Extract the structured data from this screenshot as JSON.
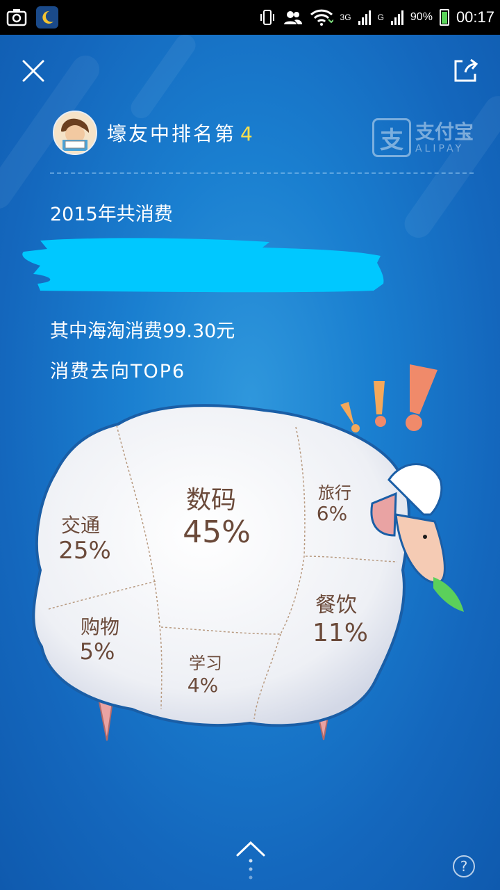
{
  "status_bar": {
    "time": "00:17",
    "battery": "90%",
    "network_3g": "3G",
    "network_g": "G"
  },
  "header": {
    "rank_prefix": "壕友中排名第",
    "rank_number": "4",
    "brand_cn": "支付宝",
    "brand_en": "ALIPAY",
    "brand_mark": "支"
  },
  "summary": {
    "total_label": "2015年共消费",
    "overseas": "其中海淘消费99.30元",
    "top_label": "消费去向TOP6"
  },
  "chart_data": {
    "type": "pie",
    "categories": [
      "数码",
      "交通",
      "餐饮",
      "旅行",
      "购物",
      "学习"
    ],
    "values": [
      45,
      25,
      11,
      6,
      5,
      4
    ],
    "value_labels": [
      "45%",
      "25%",
      "11%",
      "6%",
      "5%",
      "4%"
    ],
    "unit": "%"
  },
  "icons": {
    "close": "close-icon",
    "share": "share-icon",
    "help": "?",
    "up": "chevron-up-icon"
  },
  "colors": {
    "background": "#1a7fd0",
    "rank_highlight": "#ffe14a",
    "redaction": "#00c8ff"
  }
}
